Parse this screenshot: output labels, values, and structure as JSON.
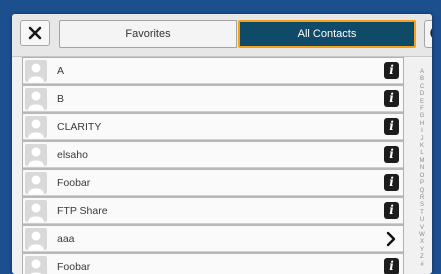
{
  "tabs": {
    "favorites_label": "Favorites",
    "all_contacts_label": "All Contacts"
  },
  "colors": {
    "active_tab": "#0f4a69",
    "active_tab_border": "#f5a21b",
    "background": "#1b4f8e",
    "info_button": "#1c1c1c"
  },
  "icons": {
    "close": "close-icon",
    "search": "search-icon",
    "avatar": "person-avatar-icon",
    "info": "info-icon",
    "chevron": "chevron-right-icon"
  },
  "contacts": [
    {
      "name": "A",
      "action": "info"
    },
    {
      "name": "B",
      "action": "info"
    },
    {
      "name": "CLARITY",
      "action": "info"
    },
    {
      "name": "elsaho",
      "action": "info"
    },
    {
      "name": "Foobar",
      "action": "info"
    },
    {
      "name": "FTP Share",
      "action": "info"
    },
    {
      "name": "aaa",
      "action": "chevron"
    },
    {
      "name": "Foobar",
      "action": "info"
    }
  ],
  "index_letters": [
    "A",
    "B",
    "C",
    "D",
    "E",
    "F",
    "G",
    "H",
    "I",
    "J",
    "K",
    "L",
    "M",
    "N",
    "O",
    "P",
    "Q",
    "R",
    "S",
    "T",
    "U",
    "V",
    "W",
    "X",
    "Y",
    "Z",
    "#"
  ]
}
